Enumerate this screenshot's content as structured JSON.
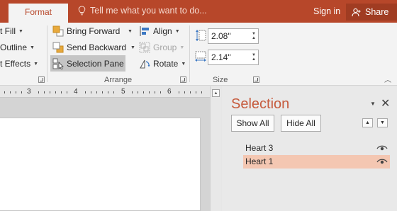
{
  "tabs": {
    "format": "Format"
  },
  "search": {
    "placeholder": "Tell me what you want to do..."
  },
  "account": {
    "signin": "Sign in",
    "share": "Share"
  },
  "ribbon": {
    "shape_styles": {
      "fill": "t Fill",
      "outline": "Outline",
      "effects": "t Effects"
    },
    "arrange": {
      "bring_forward": "Bring Forward",
      "send_backward": "Send Backward",
      "selection_pane": "Selection Pane",
      "align": "Align",
      "group": "Group",
      "rotate": "Rotate",
      "label": "Arrange"
    },
    "size": {
      "height": "2.08\"",
      "width": "2.14\"",
      "label": "Size"
    }
  },
  "ruler": {
    "numbers": [
      "3",
      "4",
      "5",
      "6"
    ]
  },
  "selection_pane": {
    "title": "Selection",
    "show_all": "Show All",
    "hide_all": "Hide All",
    "items": [
      {
        "label": "Heart 3",
        "selected": false
      },
      {
        "label": "Heart 1",
        "selected": true
      }
    ]
  },
  "colors": {
    "accent": "#b7472a",
    "pane_title": "#c65a3c",
    "selected_item": "#f4c7b2"
  }
}
